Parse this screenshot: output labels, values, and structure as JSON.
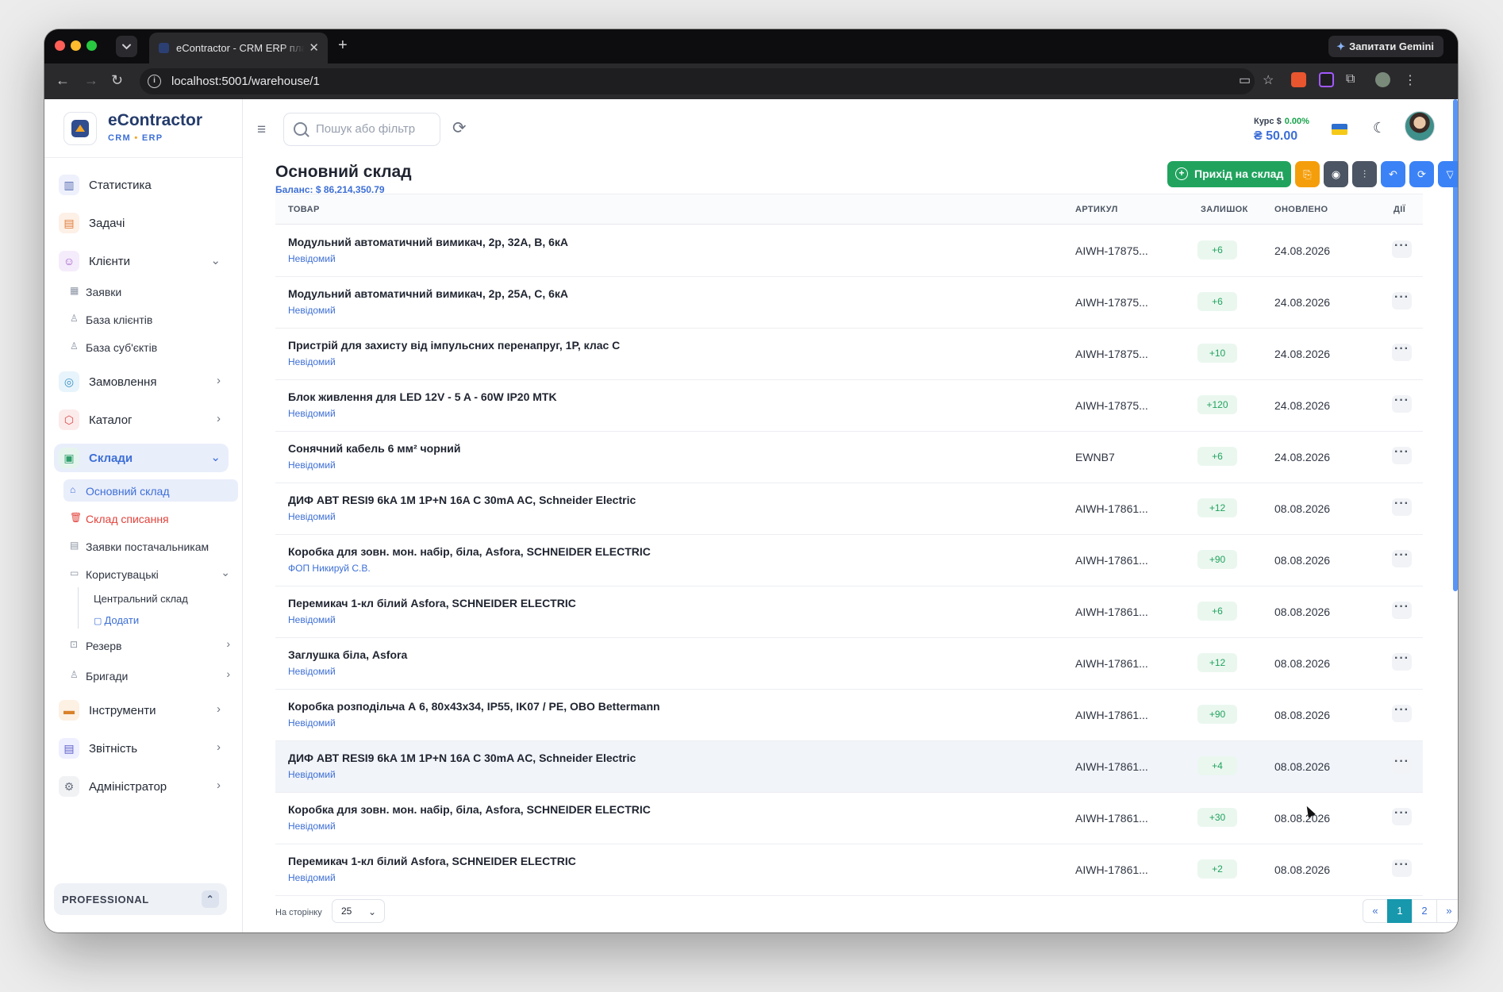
{
  "browser": {
    "tab_title": "eContractor - CRM ERP плат",
    "url": "localhost:5001/warehouse/1",
    "gemini_label": "Запитати Gemini"
  },
  "brand": {
    "name": "eContractor",
    "sub_crm": "CRM",
    "sub_sep": "•",
    "sub_erp": "ERP"
  },
  "sidebar": {
    "stats": "Статистика",
    "tasks": "Задачі",
    "clients": "Клієнти",
    "requests": "Заявки",
    "client_base": "База клієнтів",
    "subject_base": "База суб'єктів",
    "orders": "Замовлення",
    "catalog": "Каталог",
    "warehouses": "Склади",
    "main_wh": "Основний склад",
    "writeoff_wh": "Склад списання",
    "supplier_req": "Заявки постачальникам",
    "custom": "Користувацькі",
    "central_wh": "Центральний склад",
    "add": "Додати",
    "reserve": "Резерв",
    "crews": "Бригади",
    "tools": "Інструменти",
    "reports": "Звітність",
    "admin": "Адміністратор",
    "plan": "PROFESSIONAL"
  },
  "topbar": {
    "search_placeholder": "Пошук або фільтр",
    "rate_label": "Курс $",
    "rate_change": "0.00%",
    "rate_value": "₴ 50.00"
  },
  "page": {
    "title": "Основний склад",
    "balance": "Баланс: $ 86,214,350.79",
    "btn_incoming": "Прихід на склад"
  },
  "table": {
    "headers": {
      "product": "ТОВАР",
      "sku": "АРТИКУЛ",
      "qty": "ЗАЛИШОК",
      "updated": "ОНОВЛЕНО",
      "actions": "ДІЇ"
    },
    "rows": [
      {
        "name": "Модульний автоматичний вимикач, 2р, 32А, В, 6кА",
        "supplier": "Невідомий",
        "sku": "AIWH-17875...",
        "qty": "+6",
        "date": "24.08.2026"
      },
      {
        "name": "Модульний автоматичний вимикач, 2р, 25А, С, 6кА",
        "supplier": "Невідомий",
        "sku": "AIWH-17875...",
        "qty": "+6",
        "date": "24.08.2026"
      },
      {
        "name": "Пристрій для захисту від імпульсних перенапруг, 1Р, клас С",
        "supplier": "Невідомий",
        "sku": "AIWH-17875...",
        "qty": "+10",
        "date": "24.08.2026"
      },
      {
        "name": "Блок живлення для LED 12V - 5 A - 60W IP20 MTK",
        "supplier": "Невідомий",
        "sku": "AIWH-17875...",
        "qty": "+120",
        "date": "24.08.2026"
      },
      {
        "name": "Сонячний кабель 6 мм² чорний",
        "supplier": "Невідомий",
        "sku": "EWNB7",
        "qty": "+6",
        "date": "24.08.2026"
      },
      {
        "name": "ДИФ АВТ RESI9 6kA 1M 1P+N 16A C 30mA AC, Schneider Electric",
        "supplier": "Невідомий",
        "sku": "AIWH-17861...",
        "qty": "+12",
        "date": "08.08.2026"
      },
      {
        "name": "Коробка для зовн. мон. набір, біла, Asfora, SCHNEIDER ELECTRIC",
        "supplier": "ФОП Никируй С.В.",
        "sku": "AIWH-17861...",
        "qty": "+90",
        "date": "08.08.2026"
      },
      {
        "name": "Перемикач 1-кл білий Asfora, SCHNEIDER ELECTRIC",
        "supplier": "Невідомий",
        "sku": "AIWH-17861...",
        "qty": "+6",
        "date": "08.08.2026"
      },
      {
        "name": "Заглушка біла, Asfora",
        "supplier": "Невідомий",
        "sku": "AIWH-17861...",
        "qty": "+12",
        "date": "08.08.2026"
      },
      {
        "name": "Коробка розподільча А 6, 80х43х34, IP55, IK07 / PE, OBO Bettermann",
        "supplier": "Невідомий",
        "sku": "AIWH-17861...",
        "qty": "+90",
        "date": "08.08.2026"
      },
      {
        "name": "ДИФ АВТ RESI9 6kA 1M 1P+N 16A C 30mA AC, Schneider Electric",
        "supplier": "Невідомий",
        "sku": "AIWH-17861...",
        "qty": "+4",
        "date": "08.08.2026"
      },
      {
        "name": "Коробка для зовн. мон. набір, біла, Asfora, SCHNEIDER ELECTRIC",
        "supplier": "Невідомий",
        "sku": "AIWH-17861...",
        "qty": "+30",
        "date": "08.08.2026"
      },
      {
        "name": "Перемикач 1-кл білий Asfora, SCHNEIDER ELECTRIC",
        "supplier": "Невідомий",
        "sku": "AIWH-17861...",
        "qty": "+2",
        "date": "08.08.2026"
      }
    ]
  },
  "pagination": {
    "per_page_label": "На сторінку",
    "per_page": "25",
    "prev": "«",
    "p1": "1",
    "p2": "2",
    "next": "»"
  },
  "colors": {
    "accent": "#3d6fd6",
    "success": "#21a35e",
    "orange": "#f59e0b",
    "dark": "#4b5563",
    "blue": "#3b82f6"
  },
  "icons": {
    "refresh": "refresh-icon",
    "moon": "moon-icon",
    "search": "search-icon",
    "menu": "hamburger-icon"
  }
}
